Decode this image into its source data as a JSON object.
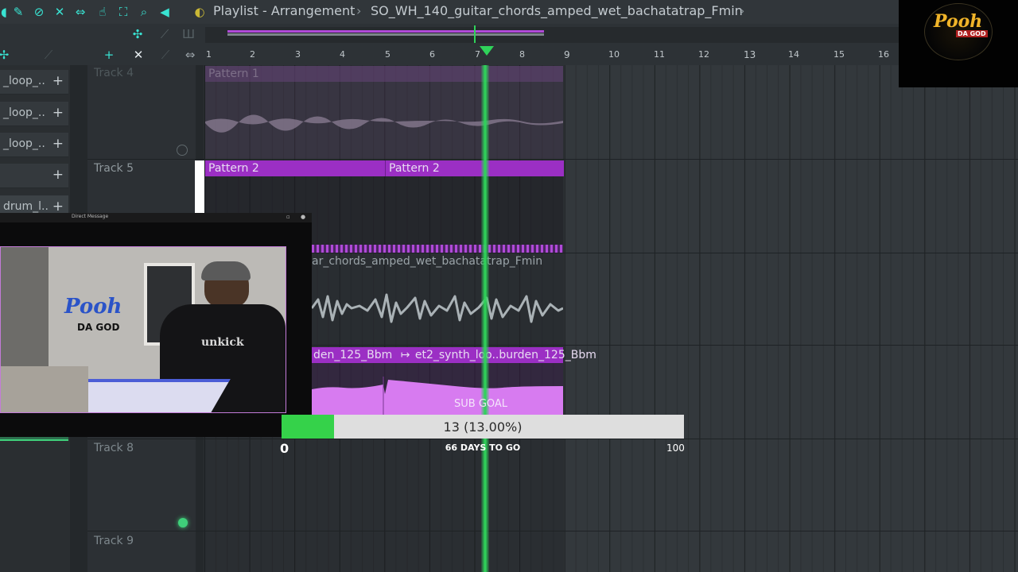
{
  "window": {
    "title_prefix": "Playlist - Arrangement",
    "separator": "›",
    "file_name": "SO_WH_140_guitar_chords_amped_wet_bachatatrap_Fmin",
    "trailing": "›"
  },
  "ruler": {
    "bars": [
      "1",
      "2",
      "3",
      "4",
      "5",
      "6",
      "7",
      "8",
      "9",
      "10",
      "11",
      "12",
      "13",
      "14",
      "15",
      "16"
    ]
  },
  "sidebar": {
    "items": [
      {
        "label": "_loop_..",
        "icon": "+"
      },
      {
        "label": "_loop_..",
        "icon": "+"
      },
      {
        "label": "_loop_..",
        "icon": "+"
      },
      {
        "label": "",
        "icon": "+"
      },
      {
        "label": "drum_l..",
        "icon": "+"
      }
    ]
  },
  "tracks": {
    "track4": "Track 4",
    "track5": "Track 5",
    "track8": "Track 8",
    "track9": "Track 9"
  },
  "clips": {
    "pattern1": "Pattern 1",
    "pattern2a": "Pattern 2",
    "pattern2b": "Pattern 2",
    "guitar_audio": "ar_chords_amped_wet_bachatatrap_Fmin",
    "synth_a": "den_125_Bbm",
    "synth_b": "et2_synth_loo..burden_125_Bbm",
    "synth_arrow": "↦"
  },
  "webcam": {
    "window_title": "Direct Message",
    "logo_line1": "Pooh",
    "logo_line2": "DA GOD",
    "hoodie_text": "unkick"
  },
  "overlay_logo": {
    "line1": "Pooh",
    "line2": "DA GOD"
  },
  "sub_goal": {
    "label": "SUB GOAL",
    "progress_text": "13 (13.00%)",
    "current": 13,
    "percent": 13.0,
    "min_label": "0",
    "max_label": "100",
    "days_text": "66 DAYS TO GO"
  },
  "colors": {
    "accent_cyan": "#39e3d2",
    "pattern_purple": "#9b2fc4",
    "playhead_green": "#2fd35a",
    "goal_green": "#35d24a",
    "audio_pink": "#d77bf0"
  }
}
